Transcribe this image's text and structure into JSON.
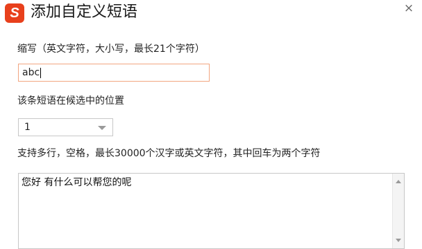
{
  "window": {
    "logo_glyph": "S",
    "title": "添加自定义短语",
    "close_glyph": "×",
    "accent_color": "#e8401c"
  },
  "abbreviation": {
    "label": "缩写（英文字符，大小写，最长21个字符）",
    "value": "abc"
  },
  "position": {
    "label": "该条短语在候选中的位置",
    "selected": "1"
  },
  "content": {
    "label": "支持多行，空格，最长30000个汉字或英文字符，其中回车为两个字符",
    "value": "您好 有什么可以帮您的呢"
  }
}
